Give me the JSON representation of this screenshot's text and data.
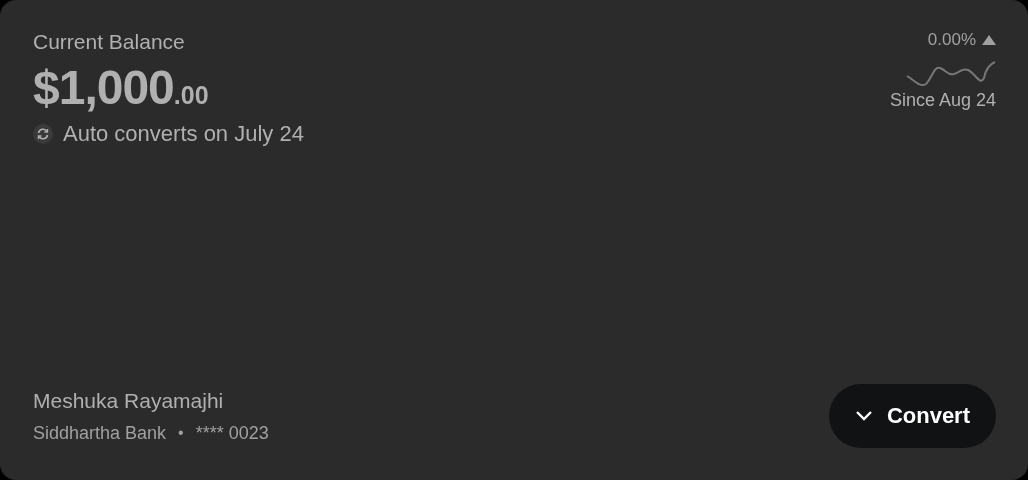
{
  "balance": {
    "label": "Current Balance",
    "amount": "$1,000",
    "cents": ".00",
    "auto_convert": "Auto converts on July 24"
  },
  "change": {
    "percent": "0.00%",
    "since": "Since Aug 24"
  },
  "account": {
    "holder": "Meshuka Rayamajhi",
    "bank": "Siddhartha Bank",
    "separator": "•",
    "number": "**** 0023"
  },
  "button": {
    "label": "Convert"
  }
}
